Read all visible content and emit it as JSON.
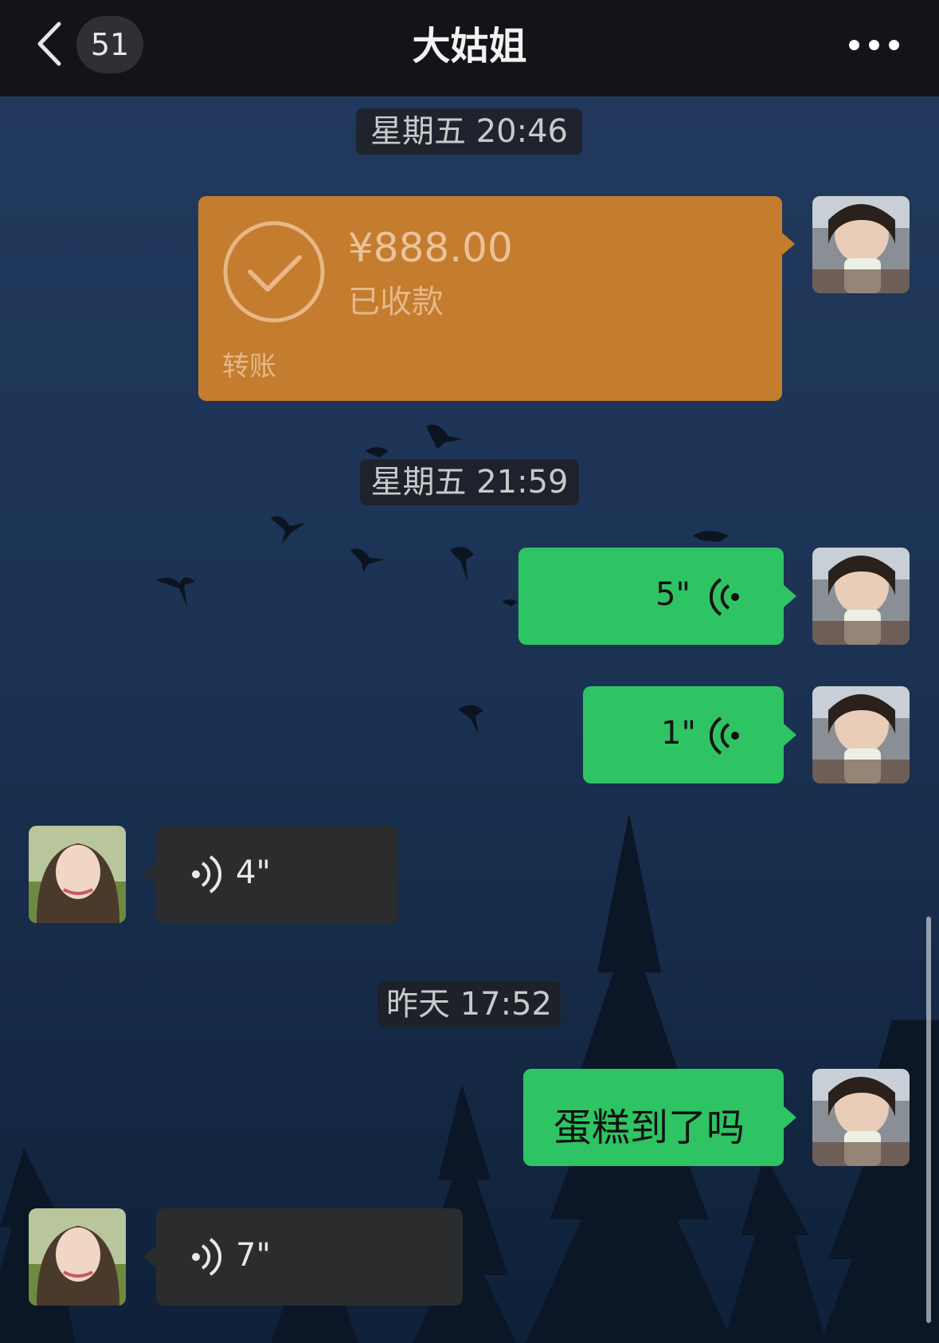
{
  "header": {
    "unread_count": "51",
    "title": "大姑姐"
  },
  "messages": {
    "time1": "星期五 20:46",
    "transfer": {
      "amount": "¥888.00",
      "status": "已收款",
      "label": "转账"
    },
    "time2": "星期五 21:59",
    "voice_out_1": "5\"",
    "voice_out_2": "1\"",
    "voice_in_1": "4\"",
    "time3": "昨天 17:52",
    "text_out_1": "蛋糕到了吗",
    "voice_in_2": "7\""
  },
  "colors": {
    "header_bg": "#121418",
    "sent_bubble": "#2ec463",
    "received_bubble": "#2b2c2e",
    "transfer_bubble": "#c47c2e"
  }
}
